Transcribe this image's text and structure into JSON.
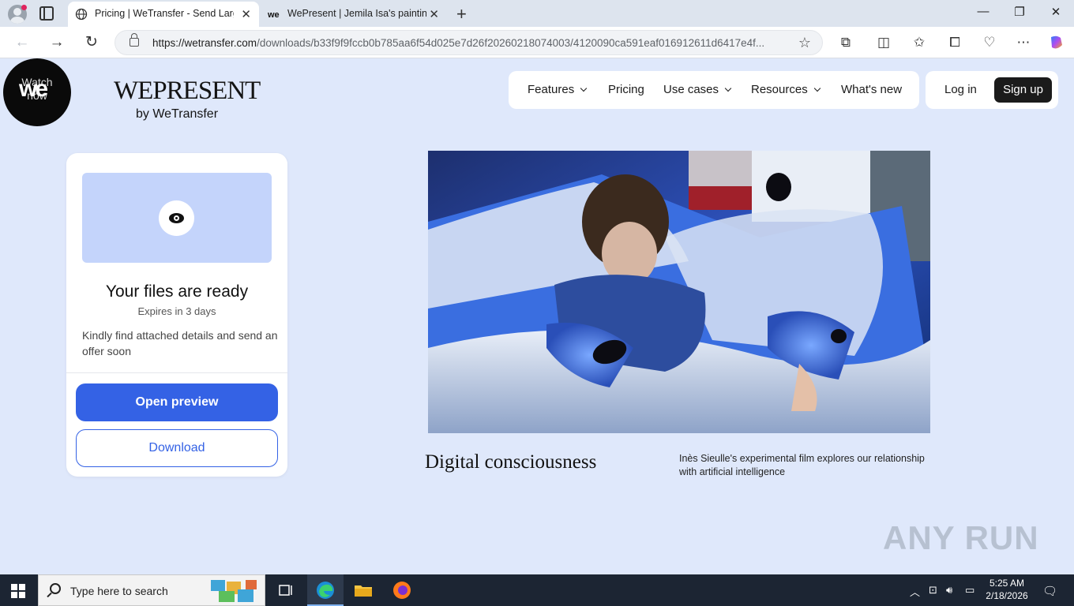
{
  "browser": {
    "tabs": [
      {
        "title": "Pricing | WeTransfer - Send Large",
        "active": true
      },
      {
        "title": "WePresent | Jemila Isa's paintings",
        "active": false
      }
    ],
    "url_host": "https://wetransfer.com",
    "url_path": "/downloads/b33f9f9fccb0b785aa6f54d025e7d26f20260218074003/4120090ca591eaf016912611d6417e4f..."
  },
  "site": {
    "badge_text": "Watch now",
    "badge_logo": "we",
    "brand_name": "WEPRESENT",
    "brand_by": "by WeTransfer",
    "nav": [
      {
        "label": "Features",
        "dropdown": true
      },
      {
        "label": "Pricing",
        "dropdown": false
      },
      {
        "label": "Use cases",
        "dropdown": true
      },
      {
        "label": "Resources",
        "dropdown": true
      },
      {
        "label": "What's new",
        "dropdown": false
      }
    ],
    "login_label": "Log in",
    "signup_label": "Sign up"
  },
  "transfer_card": {
    "title": "Your files are ready",
    "expiry": "Expires in 3 days",
    "message": "Kindly find attached details and send an offer soon",
    "primary_button": "Open preview",
    "secondary_button": "Download",
    "accent_color": "#3462e5"
  },
  "article": {
    "title": "Digital consciousness",
    "description": "Inès Sieulle's experimental film explores our relationship with artificial intelligence"
  },
  "watermark": "ANY RUN",
  "taskbar": {
    "search_placeholder": "Type here to search",
    "time": "5:25 AM",
    "date": "2/18/2026"
  }
}
